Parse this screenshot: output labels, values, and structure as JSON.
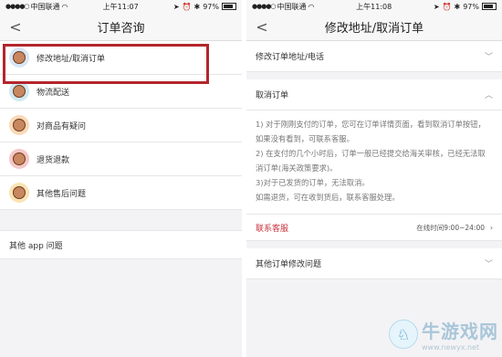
{
  "left": {
    "status": {
      "carrier": "中国联通",
      "time": "上午11:07",
      "battery": "97%"
    },
    "nav": {
      "title": "订单咨询"
    },
    "items": [
      {
        "label": "修改地址/取消订单",
        "color": "#d8e6f3"
      },
      {
        "label": "物流配送",
        "color": "#cfe9f2"
      },
      {
        "label": "对商品有疑问",
        "color": "#fbd9b6"
      },
      {
        "label": "退货退款",
        "color": "#f6c6c6"
      },
      {
        "label": "其他售后问题",
        "color": "#fbe3b3"
      }
    ],
    "other": {
      "label": "其他 app 问题"
    }
  },
  "right": {
    "status": {
      "carrier": "中国联通",
      "time": "上午11:08",
      "battery": "97%"
    },
    "nav": {
      "title": "修改地址/取消订单"
    },
    "q1": {
      "label": "修改订单地址/电话"
    },
    "q2": {
      "label": "取消订单"
    },
    "answer": {
      "line1": "1) 对于刚刚支付的订单，您可在订单详情页面，看到取消订单按钮，如果没有看到，可联系客服。",
      "line2": "2) 在支付的几个小时后，订单一般已经提交给海关审核，已经无法取消订单(海关政策要求)。",
      "line3": "3)对于已发货的订单，无法取消。",
      "line4": "如需退货，可在收到货后，联系客服处理。"
    },
    "contact": {
      "label": "联系客服",
      "hours": "在线时间9:00~24:00"
    },
    "q3": {
      "label": "其他订单修改问题"
    }
  },
  "watermark": {
    "text": "牛游戏网",
    "url": "www.newyx.net"
  }
}
